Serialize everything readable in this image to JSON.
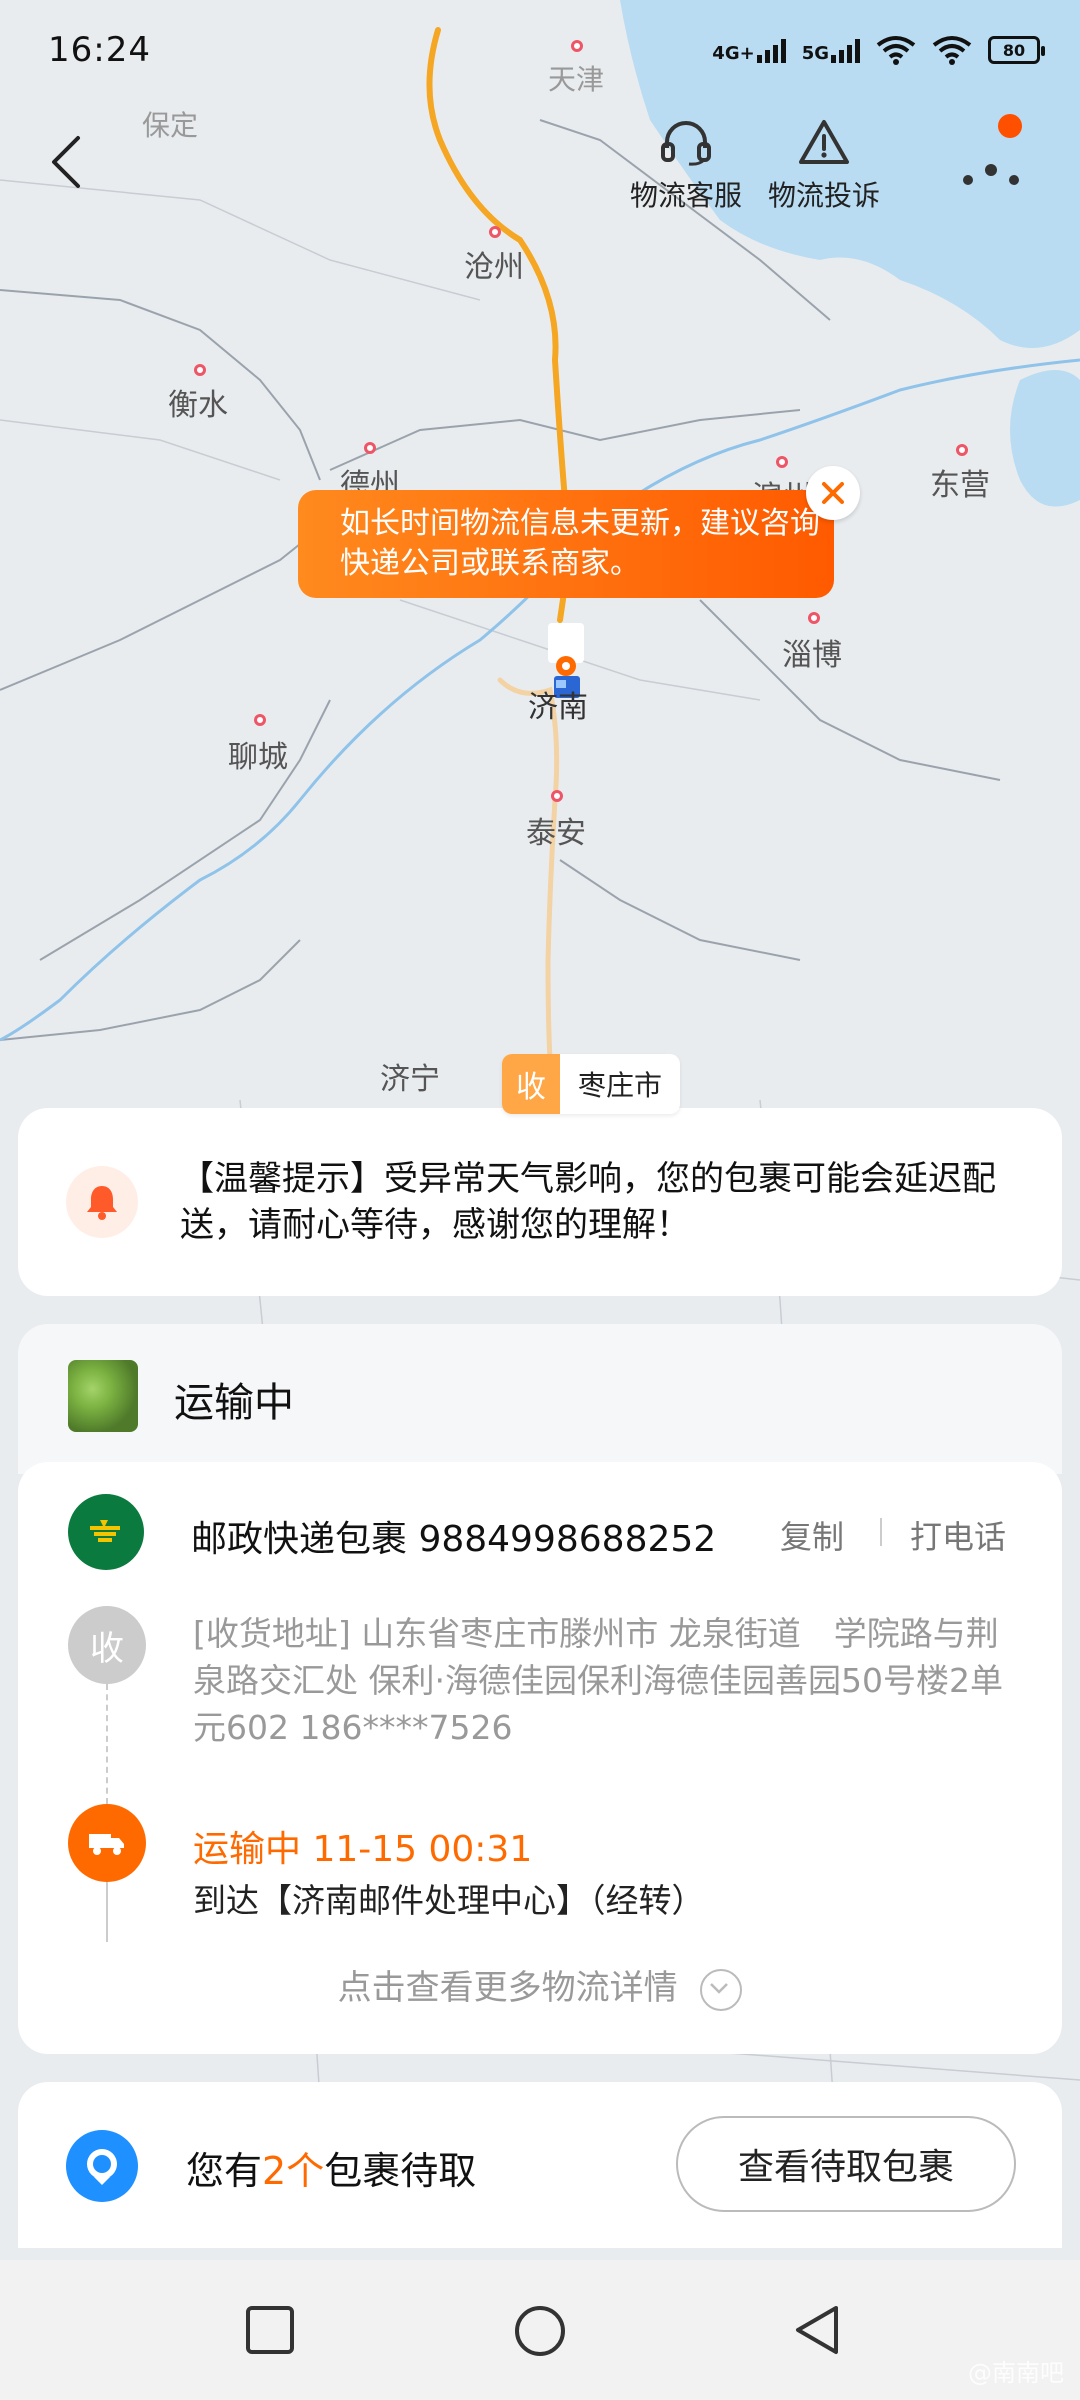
{
  "status_bar": {
    "time": "16:24",
    "network1": "4G+",
    "network2": "5G",
    "battery": "80"
  },
  "header": {
    "service_label": "物流客服",
    "complaint_label": "物流投诉"
  },
  "map": {
    "cities": [
      "天津",
      "保定",
      "沧州",
      "衡水",
      "德州",
      "滨州",
      "东营",
      "淄博",
      "济南",
      "聊城",
      "泰安",
      "济宁"
    ],
    "bubble_text": "如长时间物流信息未更新，建议咨询快递公司或联系商家。",
    "dest_badge": "收",
    "dest_name": "枣庄市"
  },
  "notice": {
    "text": "【温馨提示】受异常天气影响，您的包裹可能会延迟配送，请耐心等待，感谢您的理解！"
  },
  "shipment": {
    "status_title": "运输中",
    "carrier_line": "邮政快递包裹 9884998688252",
    "copy_label": "复制",
    "call_label": "打电话",
    "receive_badge": "收",
    "address": "[收货地址] 山东省枣庄市滕州市 龙泉街道　学院路与荆泉路交汇处 保利·海德佳园保利海德佳园善园50号楼2单元602 186****7526",
    "latest_status": "运输中 11-15 00:31",
    "latest_desc": "到达【济南邮件处理中心】（经转）",
    "more_link": "点击查看更多物流详情"
  },
  "pickup": {
    "prefix": "您有",
    "count": "2个",
    "suffix": "包裹待取",
    "button": "查看待取包裹"
  },
  "watermark": "@南南吧",
  "colors": {
    "accent": "#ff6a00",
    "route": "#f5a623",
    "post_green": "#0a7a3e",
    "pickup_blue": "#1e90ff"
  }
}
